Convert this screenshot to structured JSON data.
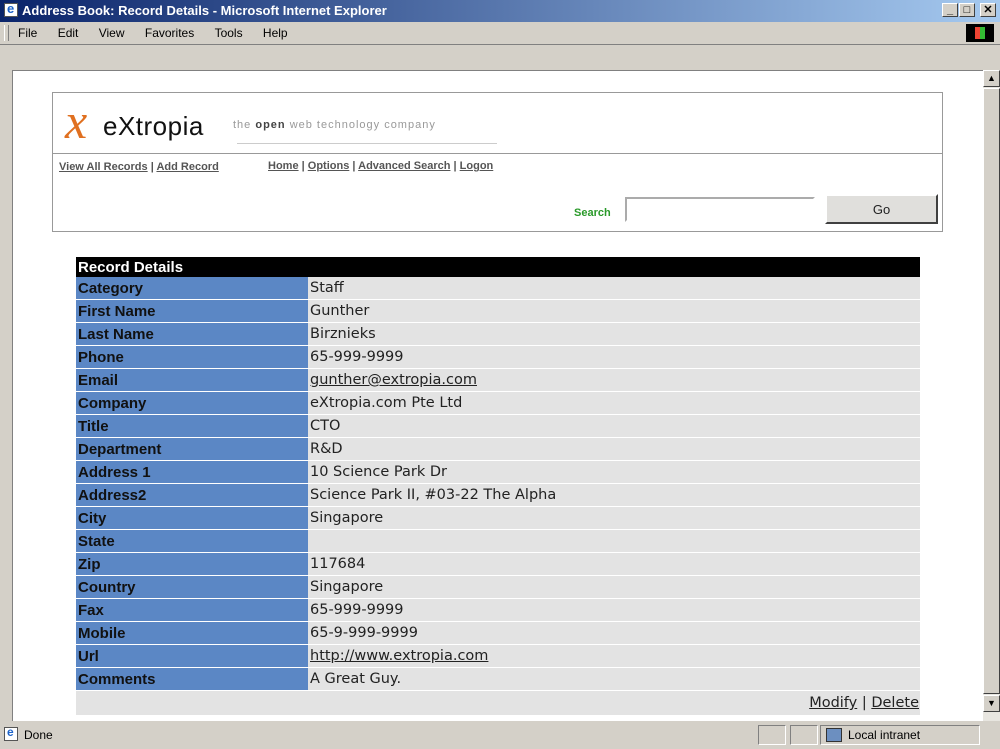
{
  "window": {
    "title": "Address Book: Record Details - Microsoft Internet Explorer",
    "controls": {
      "minimize": "_",
      "maximize": "□",
      "close": "✕"
    }
  },
  "menu": [
    "File",
    "Edit",
    "View",
    "Favorites",
    "Tools",
    "Help"
  ],
  "logo": {
    "brand": "eXtropia",
    "tagline_pre": "the ",
    "tagline_bold": "open",
    "tagline_post": " web technology company"
  },
  "nav": {
    "view_all": "View All Records",
    "add_record": "Add Record",
    "home": "Home",
    "options": "Options",
    "advanced_search": "Advanced Search",
    "logon": "Logon",
    "separator": "|"
  },
  "search": {
    "label": "Search",
    "value": "",
    "button": "Go"
  },
  "record": {
    "header": "Record Details",
    "fields": [
      {
        "label": "Category",
        "value": "Staff"
      },
      {
        "label": "First Name",
        "value": "Gunther"
      },
      {
        "label": "Last Name",
        "value": "Birznieks"
      },
      {
        "label": "Phone",
        "value": "65-999-9999"
      },
      {
        "label": "Email",
        "value": "gunther@extropia.com"
      },
      {
        "label": "Company",
        "value": "eXtropia.com Pte Ltd"
      },
      {
        "label": "Title",
        "value": "CTO"
      },
      {
        "label": "Department",
        "value": "R&D"
      },
      {
        "label": "Address 1",
        "value": "10 Science Park Dr"
      },
      {
        "label": "Address2",
        "value": "Science Park II, #03-22 The Alpha"
      },
      {
        "label": "City",
        "value": "Singapore"
      },
      {
        "label": "State",
        "value": ""
      },
      {
        "label": "Zip",
        "value": "117684"
      },
      {
        "label": "Country",
        "value": "Singapore"
      },
      {
        "label": "Fax",
        "value": "65-999-9999"
      },
      {
        "label": "Mobile",
        "value": "65-9-999-9999"
      },
      {
        "label": "Url",
        "value": "http://www.extropia.com"
      },
      {
        "label": "Comments",
        "value": "A Great Guy."
      }
    ],
    "actions": {
      "modify": "Modify",
      "separator": "|",
      "delete": "Delete"
    }
  },
  "status": {
    "text": "Done",
    "zone": "Local intranet"
  },
  "icons": {
    "app": "ie-icon",
    "windows_logo": "windows-logo-icon",
    "scroll_up": "arrow-up-icon",
    "scroll_down": "arrow-down-icon",
    "zone": "local-intranet-icon"
  },
  "colors": {
    "label_bg": "#5b87c5",
    "value_bg": "#e3e3e3",
    "header_bg": "#000000",
    "search_label": "#2a9a2a",
    "logo_accent": "#e07020"
  }
}
